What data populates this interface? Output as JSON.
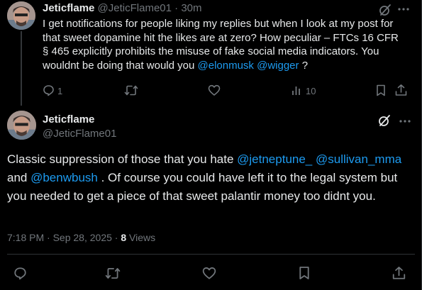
{
  "reply_tweet": {
    "display_name": "Jeticflame",
    "handle": "@JeticFlame01",
    "separator": "·",
    "time": "30m",
    "text_before": "I get notifications for people liking my replies but when I look at my post for that sweet dopamine hit the likes are at zero? How peculiar – FTCs 16 CFR § 465 explicitly prohibits the misuse of fake social media indicators. You wouldnt be doing that would you ",
    "mention_1": "@elonmusk",
    "between_mentions": " ",
    "mention_2": "@wigger",
    "text_after": " ?",
    "reply_count": "1",
    "views_count": "10",
    "icons": [
      "grok-icon",
      "more-icon",
      "reply-icon",
      "retweet-icon",
      "like-icon",
      "views-icon",
      "bookmark-icon",
      "share-icon"
    ]
  },
  "main_tweet": {
    "display_name": "Jeticflame",
    "handle": "@JeticFlame01",
    "text_before": "Classic suppression of those that you hate ",
    "mention_1": "@jetneptune_",
    "between_1": " ",
    "mention_2": "@sullivan_mma",
    "between_2": " and ",
    "mention_3": "@benwbush",
    "text_after": " . Of course you could have left it to the legal system but you needed to get a piece of that sweet palantir money too didnt you.",
    "time": "7:18 PM",
    "separator": "·",
    "date": "Sep 28, 2025",
    "separator2": "·",
    "views_count": "8",
    "views_label": " Views",
    "icons": [
      "grok-icon",
      "more-icon",
      "reply-icon",
      "retweet-icon",
      "like-icon",
      "bookmark-icon",
      "share-icon"
    ]
  },
  "colors": {
    "background": "#000000",
    "text": "#e7e9ea",
    "muted": "#71767b",
    "link": "#1d9bf0",
    "divider": "#2f3336"
  }
}
